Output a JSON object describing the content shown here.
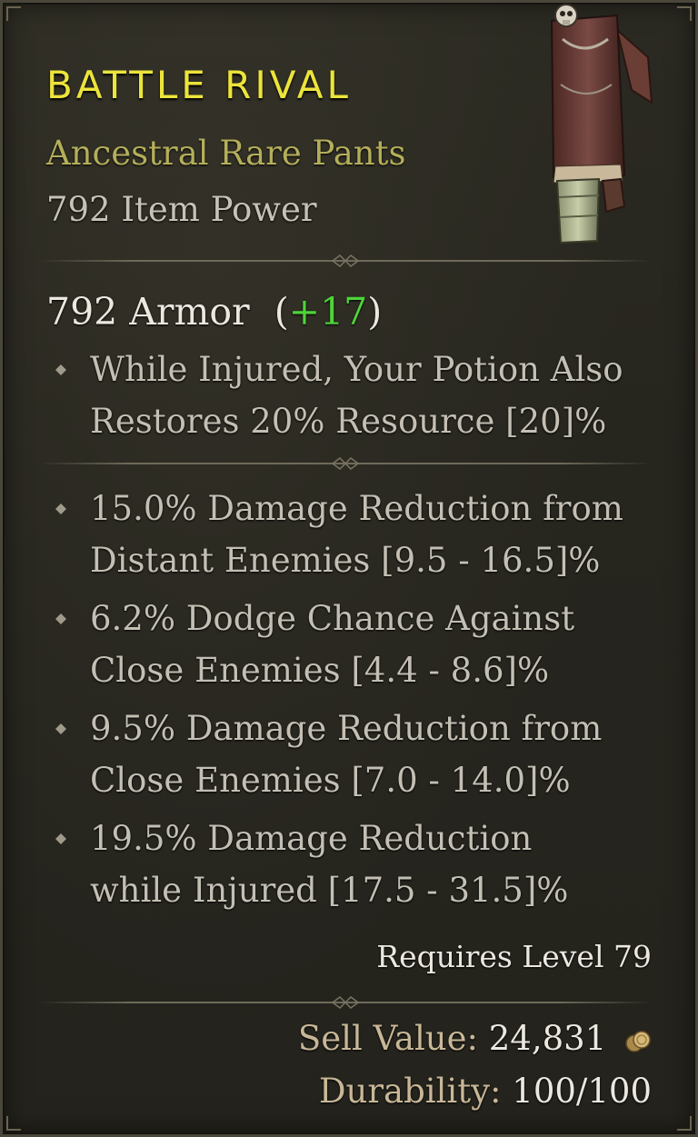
{
  "item": {
    "name": "BATTLE RIVAL",
    "type": "Ancestral Rare Pants",
    "item_power": "792 Item Power",
    "art_icon": "ancestral-pants-art"
  },
  "armor": {
    "value": "792 Armor",
    "bonus_open": "(",
    "bonus": "+17",
    "bonus_close": ")"
  },
  "implicit_affixes": [
    {
      "line1": "While Injured, Your Potion Also",
      "line2": "Restores 20% Resource [20]%"
    }
  ],
  "affixes": [
    {
      "line1": "15.0% Damage Reduction from",
      "line2": "Distant Enemies [9.5 - 16.5]%"
    },
    {
      "line1": "6.2% Dodge Chance Against",
      "line2": "Close Enemies [4.4 - 8.6]%"
    },
    {
      "line1": "9.5% Damage Reduction from",
      "line2": "Close Enemies [7.0 - 14.0]%"
    },
    {
      "line1": "19.5% Damage Reduction",
      "line2": "while Injured [17.5 - 31.5]%"
    }
  ],
  "requirements": {
    "level": "Requires Level 79"
  },
  "footer": {
    "sell_label": "Sell Value:",
    "sell_value": "24,831",
    "sell_icon": "gold-coins-icon",
    "durability_label": "Durability:",
    "durability_value": "100/100"
  },
  "colors": {
    "name": "#ece43a",
    "rarity": "#b4ae5a",
    "bonus": "#4fd43a",
    "text": "#c4bfb4",
    "label": "#c8b797"
  }
}
